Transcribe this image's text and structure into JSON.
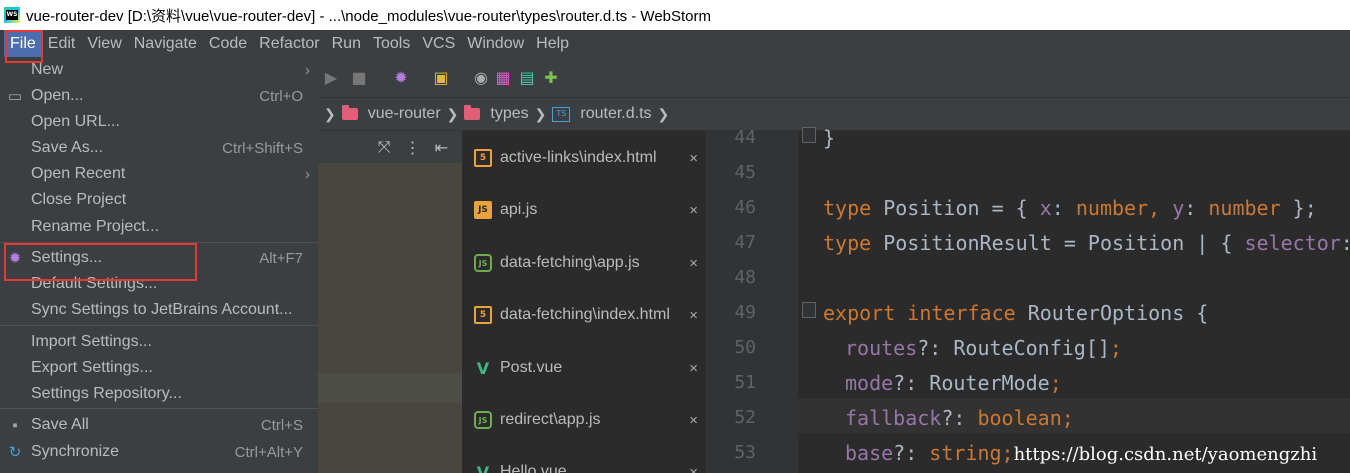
{
  "window": {
    "title": "vue-router-dev [D:\\资料\\vue\\vue-router-dev] - ...\\node_modules\\vue-router\\types\\router.d.ts - WebStorm",
    "app_icon_text": "WS"
  },
  "menubar": [
    "File",
    "Edit",
    "View",
    "Navigate",
    "Code",
    "Refactor",
    "Run",
    "Tools",
    "VCS",
    "Window",
    "Help"
  ],
  "file_menu": {
    "items": [
      {
        "label": "New",
        "shortcut": "",
        "submenu": true
      },
      {
        "label": "Open...",
        "shortcut": "Ctrl+O",
        "icon": "folder-icon"
      },
      {
        "label": "Open URL...",
        "shortcut": ""
      },
      {
        "label": "Save As...",
        "shortcut": "Ctrl+Shift+S"
      },
      {
        "label": "Open Recent",
        "shortcut": "",
        "submenu": true
      },
      {
        "label": "Close Project",
        "shortcut": ""
      },
      {
        "label": "Rename Project...",
        "shortcut": ""
      },
      {
        "label": "Settings...",
        "shortcut": "Alt+F7",
        "icon": "gear-icon"
      },
      {
        "label": "Default Settings...",
        "shortcut": ""
      },
      {
        "label": "Sync Settings to JetBrains Account...",
        "shortcut": ""
      },
      {
        "label": "Import Settings...",
        "shortcut": ""
      },
      {
        "label": "Export Settings...",
        "shortcut": ""
      },
      {
        "label": "Settings Repository...",
        "shortcut": ""
      },
      {
        "label": "Save All",
        "shortcut": "Ctrl+S",
        "icon": "save-icon"
      },
      {
        "label": "Synchronize",
        "shortcut": "Ctrl+Alt+Y",
        "icon": "sync-icon"
      }
    ]
  },
  "breadcrumb": [
    "vue-router",
    "types",
    "router.d.ts"
  ],
  "breadcrumb_file_icon": "TS",
  "recent_files": [
    {
      "name": "active-links\\index.html",
      "type": "html"
    },
    {
      "name": "api.js",
      "type": "js"
    },
    {
      "name": "data-fetching\\app.js",
      "type": "node"
    },
    {
      "name": "data-fetching\\index.html",
      "type": "html"
    },
    {
      "name": "Post.vue",
      "type": "vue"
    },
    {
      "name": "redirect\\app.js",
      "type": "node"
    },
    {
      "name": "Hello.vue",
      "type": "vue"
    }
  ],
  "editor": {
    "line_numbers": [
      "44",
      "45",
      "46",
      "47",
      "48",
      "49",
      "50",
      "51",
      "52",
      "53"
    ],
    "lines": {
      "l44": "}",
      "l46_kw": "type",
      "l46_rest": " Position = { ",
      "l46_x": "x",
      "l46_c1": ": ",
      "l46_num1": "number",
      "l46_c2": ", ",
      "l46_y": "y",
      "l46_c3": ": ",
      "l46_num2": "number",
      "l46_end": " };",
      "l47_kw": "type",
      "l47_rest": " PositionResult = Position | { ",
      "l47_sel": "selector",
      "l47_end": ":",
      "l49_kw1": "export",
      "l49_kw2": "interface",
      "l49_rest": " RouterOptions {",
      "l50_prop": "routes",
      "l50_rest": "?: RouteConfig[]",
      "l50_semi": ";",
      "l51_prop": "mode",
      "l51_rest": "?: RouterMode",
      "l51_semi": ";",
      "l52_prop": "fallback",
      "l52_rest": "?: ",
      "l52_type": "boolean",
      "l52_semi": ";",
      "l53_prop": "base",
      "l53_rest": "?: ",
      "l53_type": "string",
      "l53_semi": ";"
    },
    "watermark": "https://blog.csdn.net/yaomengzhi"
  },
  "colors": {
    "menu_bg": "#3c3f41",
    "editor_bg": "#2b2b2b",
    "highlight_box": "#e53935",
    "keyword": "#cc7832",
    "property": "#9876aa"
  }
}
